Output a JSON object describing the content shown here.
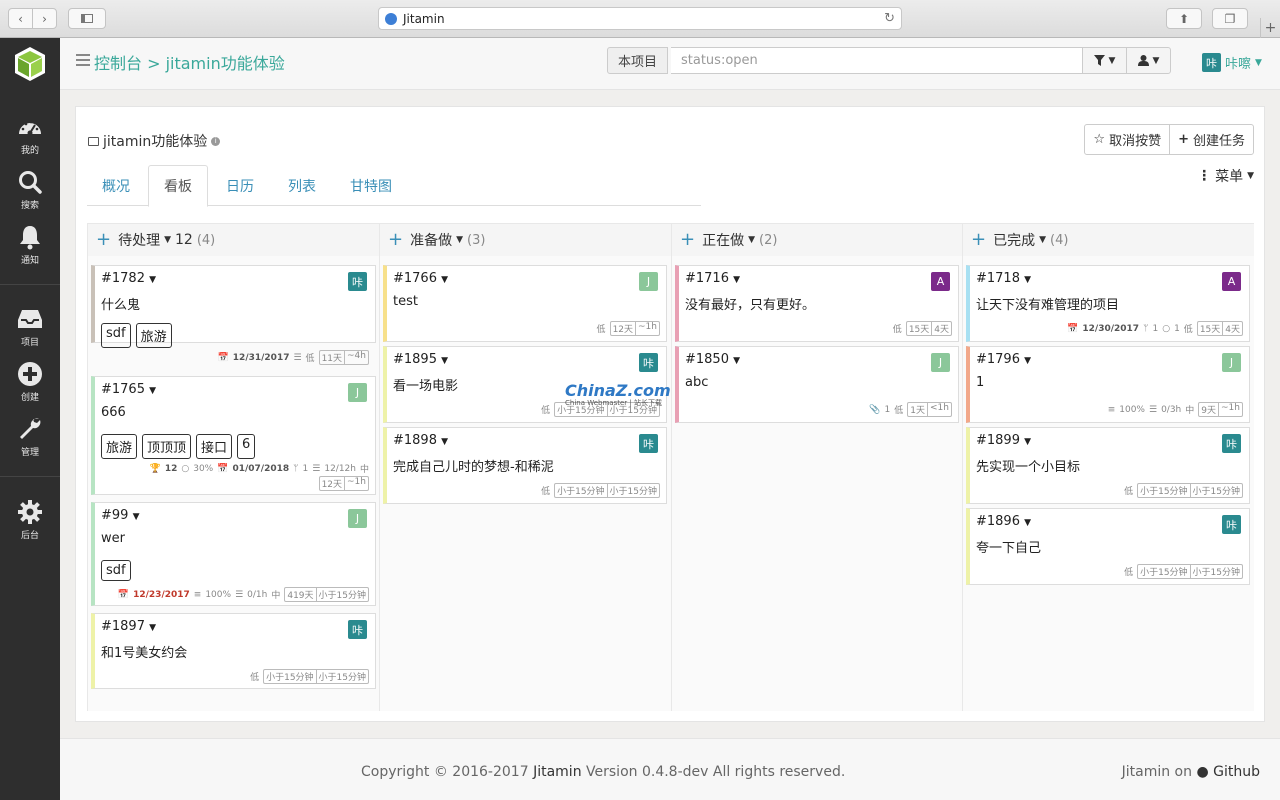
{
  "browser": {
    "url_text": "Jitamin",
    "new_tab_glyph": "+"
  },
  "leftnav": {
    "items": [
      {
        "label": "我的",
        "icon": "dashboard-icon"
      },
      {
        "label": "搜索",
        "icon": "search-icon"
      },
      {
        "label": "通知",
        "icon": "bell-icon"
      },
      {
        "label": "项目",
        "icon": "inbox-icon"
      },
      {
        "label": "创建",
        "icon": "plus-circle-icon"
      },
      {
        "label": "管理",
        "icon": "wrench-icon"
      },
      {
        "label": "后台",
        "icon": "gear-icon"
      }
    ]
  },
  "header": {
    "breadcrumb": "控制台 > jitamin功能体验",
    "scope_label": "本项目",
    "search_placeholder": "status:open",
    "user_name": "咔嚓",
    "user_avatar": "咔",
    "colors": {
      "accent": "#3aa89a",
      "link": "#3a8fb7"
    }
  },
  "project": {
    "title": "jitamin功能体验",
    "unstar_label": "取消按赞",
    "create_task_label": "创建任务",
    "menu_label": "菜单",
    "tabs": [
      "概况",
      "看板",
      "日历",
      "列表",
      "甘特图"
    ],
    "active_tab": "看板"
  },
  "columns": [
    {
      "title": "待处理",
      "limit": "12",
      "count": "(4)",
      "cards": [
        {
          "id": "#1782",
          "title": "什么鬼",
          "avatar": "咔",
          "avatar_color": "#2a8a8f",
          "border": "#c9c1b8",
          "tags": [
            "sdf",
            "旅游"
          ],
          "due": "12/31/2017",
          "priority": "低",
          "est1": "11天",
          "est2": "~4h"
        },
        {
          "id": "#1765",
          "title": "666",
          "avatar": "J",
          "avatar_color": "#8bc79a",
          "border": "#b7e4c3",
          "tags": [
            "旅游",
            "顶顶顶",
            "接口",
            "6"
          ],
          "score": "12",
          "progress": "30%",
          "due": "01/07/2018",
          "subtask": "1",
          "time": "12/12h",
          "priority": "中",
          "est1": "12天",
          "est2": "~1h"
        },
        {
          "id": "#99",
          "title": "wer",
          "avatar": "J",
          "avatar_color": "#8bc79a",
          "border": "#b7e4c3",
          "tags": [
            "sdf"
          ],
          "due": "12/23/2017",
          "progress": "100%",
          "time": "0/1h",
          "priority": "中",
          "est1": "419天",
          "est2": "小于15分钟"
        },
        {
          "id": "#1897",
          "title": "和1号美女约会",
          "avatar": "咔",
          "avatar_color": "#2a8a8f",
          "border": "#eef2a8",
          "tags": [],
          "priority": "低",
          "est1": "小于15分钟",
          "est2": "小于15分钟"
        }
      ]
    },
    {
      "title": "准备做",
      "count": "(3)",
      "cards": [
        {
          "id": "#1766",
          "title": "test",
          "avatar": "J",
          "avatar_color": "#8bc79a",
          "border": "#f7e08a",
          "priority": "低",
          "est1": "12天",
          "est2": "~1h"
        },
        {
          "id": "#1895",
          "title": "看一场电影",
          "avatar": "咔",
          "avatar_color": "#2a8a8f",
          "border": "#eef2a8",
          "priority": "低",
          "est1": "小于15分钟",
          "est2": "小于15分钟"
        },
        {
          "id": "#1898",
          "title": "完成自己儿时的梦想-和稀泥",
          "avatar": "咔",
          "avatar_color": "#2a8a8f",
          "border": "#eef2a8",
          "priority": "低",
          "est1": "小于15分钟",
          "est2": "小于15分钟"
        }
      ]
    },
    {
      "title": "正在做",
      "count": "(2)",
      "cards": [
        {
          "id": "#1716",
          "title": "没有最好，只有更好。",
          "avatar": "A",
          "avatar_color": "#7b2a8a",
          "border": "#e8a0b4",
          "priority": "低",
          "est1": "15天",
          "est2": "4天"
        },
        {
          "id": "#1850",
          "title": "abc",
          "avatar": "J",
          "avatar_color": "#8bc79a",
          "border": "#e8a0b4",
          "attach": "1",
          "priority": "低",
          "est1": "1天",
          "est2": "<1h"
        }
      ]
    },
    {
      "title": "已完成",
      "count": "(4)",
      "cards": [
        {
          "id": "#1718",
          "title": "让天下没有难管理的项目",
          "avatar": "A",
          "avatar_color": "#7b2a8a",
          "border": "#a8e0f2",
          "due": "12/30/2017",
          "subtask": "1",
          "comments": "1",
          "priority": "低",
          "est1": "15天",
          "est2": "4天"
        },
        {
          "id": "#1796",
          "title": "1",
          "avatar": "J",
          "avatar_color": "#8bc79a",
          "border": "#f2a88a",
          "progress": "100%",
          "time": "0/3h",
          "priority": "中",
          "est1": "9天",
          "est2": "~1h"
        },
        {
          "id": "#1899",
          "title": "先实现一个小目标",
          "avatar": "咔",
          "avatar_color": "#2a8a8f",
          "border": "#eef2a8",
          "priority": "低",
          "est1": "小于15分钟",
          "est2": "小于15分钟"
        },
        {
          "id": "#1896",
          "title": "夸一下自己",
          "avatar": "咔",
          "avatar_color": "#2a8a8f",
          "border": "#eef2a8",
          "priority": "低",
          "est1": "小于15分钟",
          "est2": "小于15分钟"
        }
      ]
    }
  ],
  "watermark": {
    "line1": "ChinaZ.com",
    "line2": "China Webmaster | 站长下载"
  },
  "footer": {
    "copyright_pre": "Copyright © 2016-2017",
    "brand": "Jitamin",
    "copyright_post": "Version 0.4.8-dev All rights reserved.",
    "right_pre": "Jitamin on",
    "right_link": "Github"
  }
}
